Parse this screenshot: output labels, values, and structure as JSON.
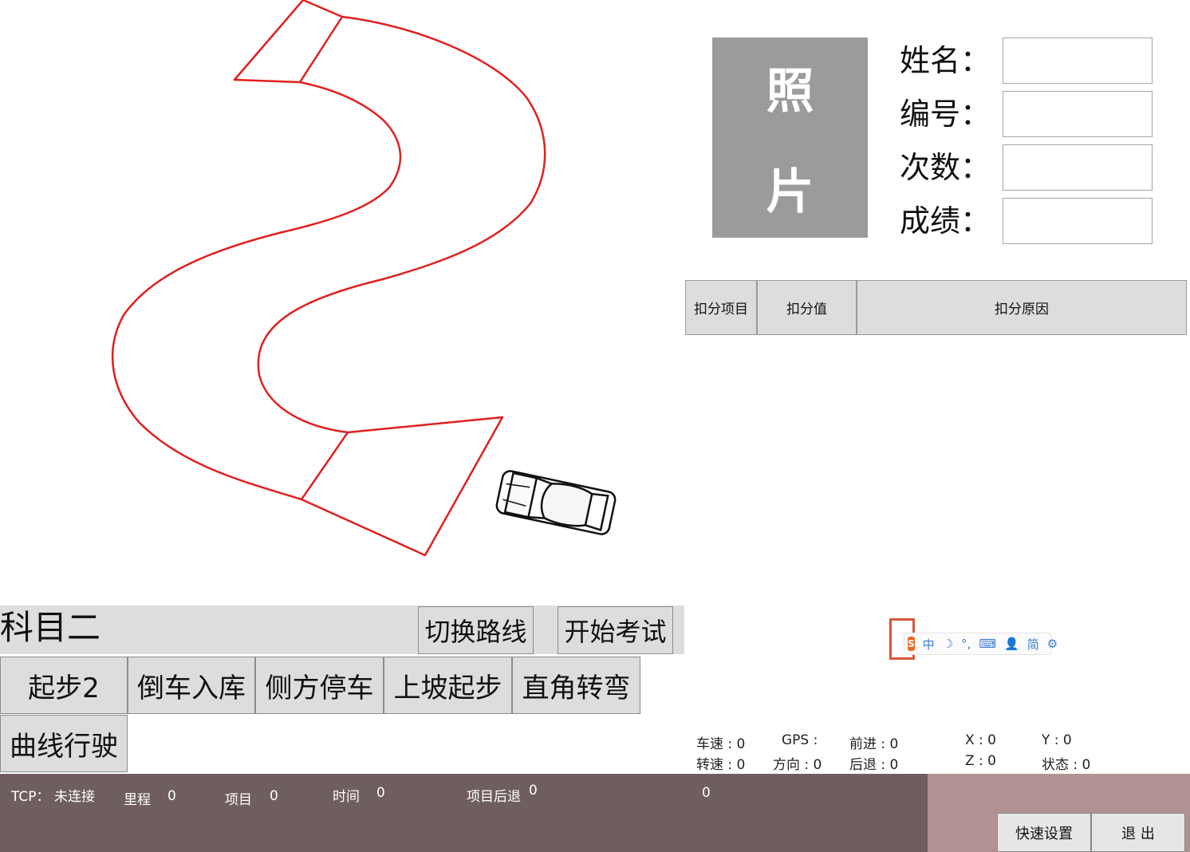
{
  "photo": {
    "char1": "照",
    "char2": "片"
  },
  "fields": [
    {
      "label": "姓名：",
      "value": ""
    },
    {
      "label": "编号：",
      "value": ""
    },
    {
      "label": "次数：",
      "value": ""
    },
    {
      "label": "成绩：",
      "value": ""
    }
  ],
  "deduction_table": {
    "headers": [
      "扣分项目",
      "扣分值",
      "扣分原因"
    ],
    "rows": []
  },
  "subject": {
    "title": "科目二",
    "switch_route": "切换路线",
    "start_exam": "开始考试"
  },
  "items": [
    "起步2",
    "倒车入库",
    "侧方停车",
    "上坡起步",
    "直角转弯",
    "曲线行驶"
  ],
  "telemetry": {
    "speed": "车速 : 0",
    "gps": "GPS :",
    "forward": "前进 : 0",
    "x": "X : 0",
    "y": "Y : 0",
    "rpm": "转速 : 0",
    "direction": "方向 : 0",
    "backward": "后退 : 0",
    "z": "Z :  0",
    "state": "状态 : 0"
  },
  "status": {
    "tcp_label": "TCP：",
    "tcp_value": "未连接",
    "mileage_label": "里程",
    "mileage_value": "0",
    "item_label": "项目",
    "item_value": "0",
    "time_label": "时间",
    "time_value": "0",
    "item_back_label": "项目后退",
    "item_back_value": "0",
    "extra_value": "0"
  },
  "buttons": {
    "quick_settings": "快速设置",
    "exit": "退 出"
  },
  "ime": {
    "logo": "S",
    "lang": "中",
    "moon": "☽",
    "punct": "°,",
    "keyboard": "⌨",
    "user": "👤",
    "simp": "简",
    "gear": "⚙"
  },
  "colors": {
    "track": "#e02020",
    "photo_bg": "#9b9b9b",
    "button_bg": "#dddddd",
    "status_bar": "#6e5e5d",
    "status_right": "#b19292"
  }
}
